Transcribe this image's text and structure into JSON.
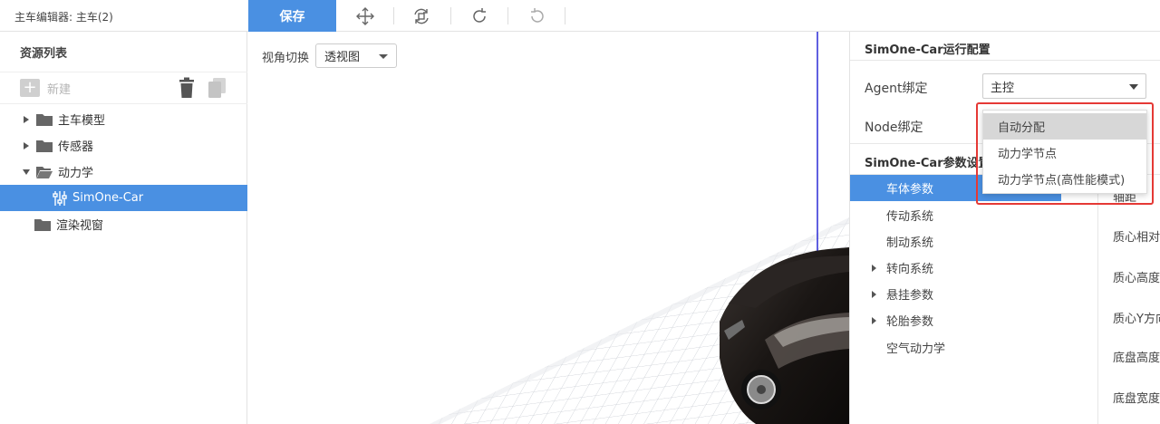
{
  "topbar": {
    "title": "主车编辑器: 主车(2)",
    "save_label": "保存",
    "tools": [
      "move-icon",
      "reset-view-icon",
      "redo-icon",
      "undo-icon"
    ]
  },
  "left_panel": {
    "title": "资源列表",
    "new_label": "新建",
    "tree": [
      {
        "label": "主车模型",
        "expanded": false
      },
      {
        "label": "传感器",
        "expanded": false
      },
      {
        "label": "动力学",
        "expanded": true
      },
      {
        "label": "SimOne-Car",
        "selected": true
      },
      {
        "label": "渲染视窗"
      }
    ]
  },
  "viewport": {
    "view_label": "视角切换",
    "view_value": "透视图"
  },
  "right_panel": {
    "run_config_title": "SimOne-Car运行配置",
    "agent_label": "Agent绑定",
    "agent_value": "主控",
    "node_label": "Node绑定",
    "param_title": "SimOne-Car参数设置",
    "menu": [
      {
        "label": "车体参数",
        "selected": true
      },
      {
        "label": "传动系统"
      },
      {
        "label": "制动系统"
      },
      {
        "label": "转向系统",
        "expandable": true
      },
      {
        "label": "悬挂参数",
        "expandable": true
      },
      {
        "label": "轮胎参数",
        "expandable": true
      },
      {
        "label": "空气动力学"
      }
    ],
    "props": [
      "轴距",
      "质心相对前",
      "质心高度",
      "质心Y方向",
      "底盘高度",
      "底盘宽度"
    ]
  },
  "node_dropdown": {
    "options": [
      "自动分配",
      "动力学节点",
      "动力学节点(高性能模式)"
    ],
    "highlighted": "自动分配"
  },
  "colors": {
    "accent": "#4a90e2",
    "highlight": "#e53935"
  }
}
